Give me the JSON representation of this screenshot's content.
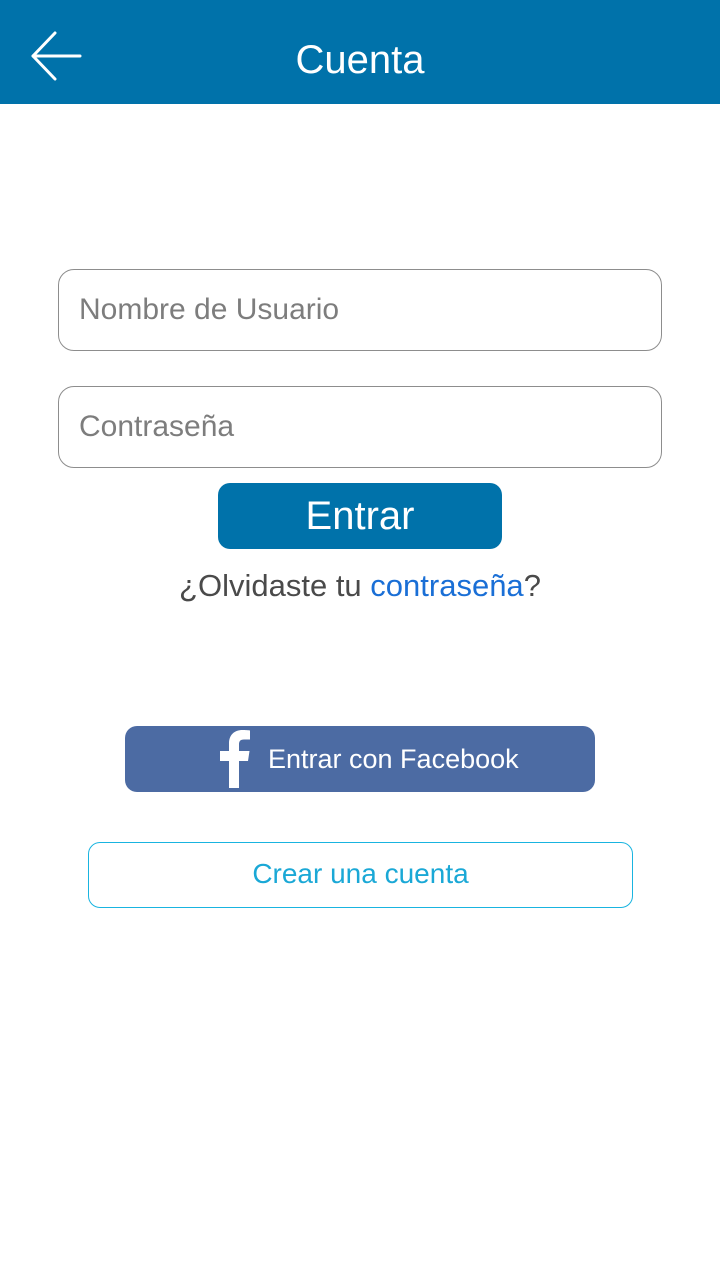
{
  "header": {
    "title": "Cuenta",
    "back_icon": "arrow-left-icon",
    "background": "#0072aa"
  },
  "form": {
    "username_placeholder": "Nombre de Usuario",
    "username_value": "",
    "password_placeholder": "Contraseña",
    "password_value": "",
    "login_label": "Entrar"
  },
  "forgot": {
    "prefix": "¿Olvidaste tu ",
    "link_label": "contraseña",
    "suffix": "?"
  },
  "social": {
    "facebook_label": "Entrar con Facebook",
    "facebook_icon": "facebook-icon",
    "facebook_color": "#4c6ba3"
  },
  "register": {
    "create_account_label": "Crear una cuenta",
    "accent": "#19b4e0"
  }
}
